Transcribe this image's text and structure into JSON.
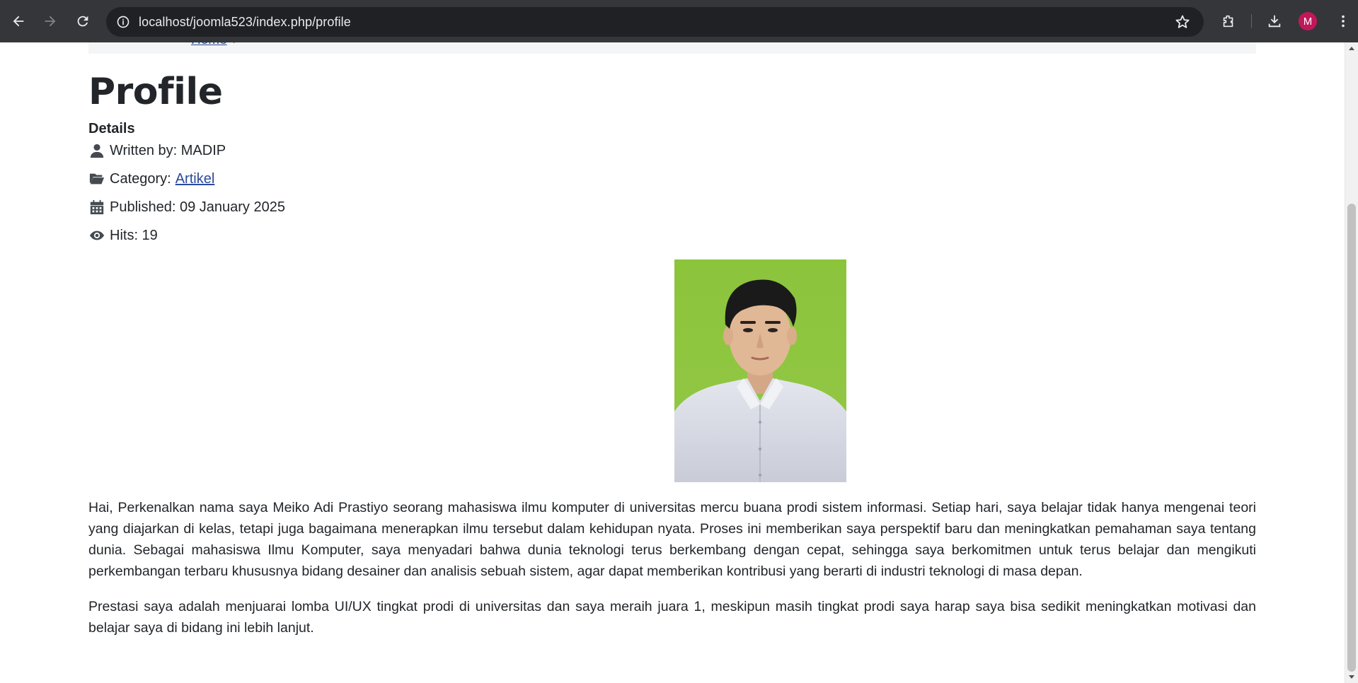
{
  "browser": {
    "url": "localhost/joomla523/index.php/profile",
    "profile_initial": "M",
    "profile_color": "#c2185b",
    "icons": [
      "back-arrow-icon",
      "forward-arrow-icon",
      "reload-icon",
      "site-info-icon",
      "bookmark-star-icon",
      "extensions-icon",
      "download-icon",
      "more-menu-icon"
    ]
  },
  "breadcrumb": {
    "link_text": "Home",
    "separator": "/"
  },
  "article": {
    "title": "Profile",
    "details_label": "Details",
    "written_by": "Written by: MADIP",
    "category_label": "Category:",
    "category_link": "Artikel",
    "published": "Published: 09 January 2025",
    "hits": "Hits: 19",
    "paragraphs": [
      "Hai, Perkenalkan nama saya Meiko Adi Prastiyo seorang mahasiswa ilmu komputer di universitas mercu buana prodi sistem informasi. Setiap hari, saya belajar tidak hanya mengenai teori yang diajarkan di kelas, tetapi juga bagaimana menerapkan ilmu tersebut dalam kehidupan nyata. Proses ini memberikan saya perspektif baru dan meningkatkan pemahaman saya tentang dunia. Sebagai mahasiswa Ilmu Komputer, saya menyadari bahwa dunia teknologi terus berkembang dengan cepat, sehingga saya berkomitmen untuk terus belajar dan mengikuti perkembangan terbaru khususnya bidang desainer dan analisis sebuah sistem, agar dapat memberikan kontribusi yang berarti di industri teknologi di masa depan.",
      "Prestasi saya adalah menjuarai lomba UI/UX tingkat prodi di universitas dan saya meraih juara 1, meskipun masih tingkat prodi saya harap saya bisa sedikit meningkatkan motivasi dan belajar saya di bidang ini lebih lanjut."
    ]
  },
  "colors": {
    "link": "#2a4a9b",
    "photo_background": "#8ec63f",
    "chrome_background": "#35363a"
  }
}
